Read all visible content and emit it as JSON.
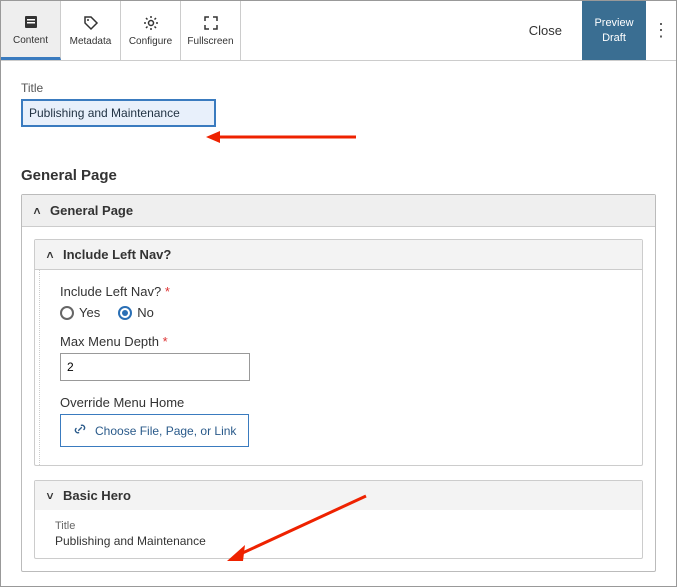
{
  "toolbar": {
    "tabs": [
      {
        "label": "Content",
        "icon": "content-icon"
      },
      {
        "label": "Metadata",
        "icon": "tag-icon"
      },
      {
        "label": "Configure",
        "icon": "gear-icon"
      },
      {
        "label": "Fullscreen",
        "icon": "fullscreen-icon"
      }
    ],
    "close": "Close",
    "preview": "Preview Draft"
  },
  "title_field": {
    "label": "Title",
    "value": "Publishing and Maintenance"
  },
  "section_heading": "General Page",
  "general_page": {
    "header": "General Page",
    "include_left_nav": {
      "header": "Include Left Nav?",
      "question": "Include Left Nav?",
      "options": {
        "yes": "Yes",
        "no": "No"
      },
      "selected": "no"
    },
    "max_depth": {
      "label": "Max Menu Depth",
      "value": "2"
    },
    "override": {
      "label": "Override Menu Home",
      "chooser": "Choose File, Page, or Link"
    },
    "basic_hero": {
      "header": "Basic Hero",
      "title_label": "Title",
      "title_value": "Publishing and Maintenance"
    }
  }
}
